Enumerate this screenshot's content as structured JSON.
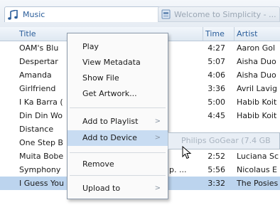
{
  "tabs": {
    "music_label": "Music",
    "welcome_label": "Welcome to Simplicity - ..."
  },
  "columns": {
    "title": "Title",
    "time": "Time",
    "artist": "Artist"
  },
  "rows": [
    {
      "title": "OAM's Blu",
      "time": "4:27",
      "artist": "Aaron Gol"
    },
    {
      "title": "Despertar",
      "time": "5:07",
      "artist": "Aisha Duo"
    },
    {
      "title": "Amanda",
      "time": "4:06",
      "artist": "Aisha Duo"
    },
    {
      "title": "Girlfriend",
      "time": "3:36",
      "artist": "Avril Lavig"
    },
    {
      "title": "I Ka Barra (",
      "time": "5:00",
      "artist": "Habib Koit"
    },
    {
      "title": "Din Din Wo",
      "time": "4:45",
      "artist": "Habib Koit"
    },
    {
      "title": "Distance",
      "time": "",
      "artist": ""
    },
    {
      "title": "One Step B",
      "time": "",
      "artist": ""
    },
    {
      "title": "Muita Bobe",
      "time": "2:52",
      "artist": "Luciana Sc"
    },
    {
      "title": "Symphony",
      "extra": "p. ...",
      "time": "5:56",
      "artist": "Nicolaus E"
    },
    {
      "title": "I Guess You",
      "time": "3:32",
      "artist": "The Posies"
    }
  ],
  "context_menu": {
    "play": "Play",
    "view_metadata": "View Metadata",
    "show_file": "Show File",
    "get_artwork": "Get Artwork...",
    "add_to_playlist": "Add to Playlist",
    "add_to_device": "Add to Device",
    "remove": "Remove",
    "upload_to": "Upload to",
    "arrow": ">"
  },
  "submenu": {
    "device": "Philips GoGear (7.4 GB"
  },
  "colors": {
    "accent": "#2a5d9a",
    "selection": "#bcd4ee",
    "hover": "#c8dcf2"
  }
}
